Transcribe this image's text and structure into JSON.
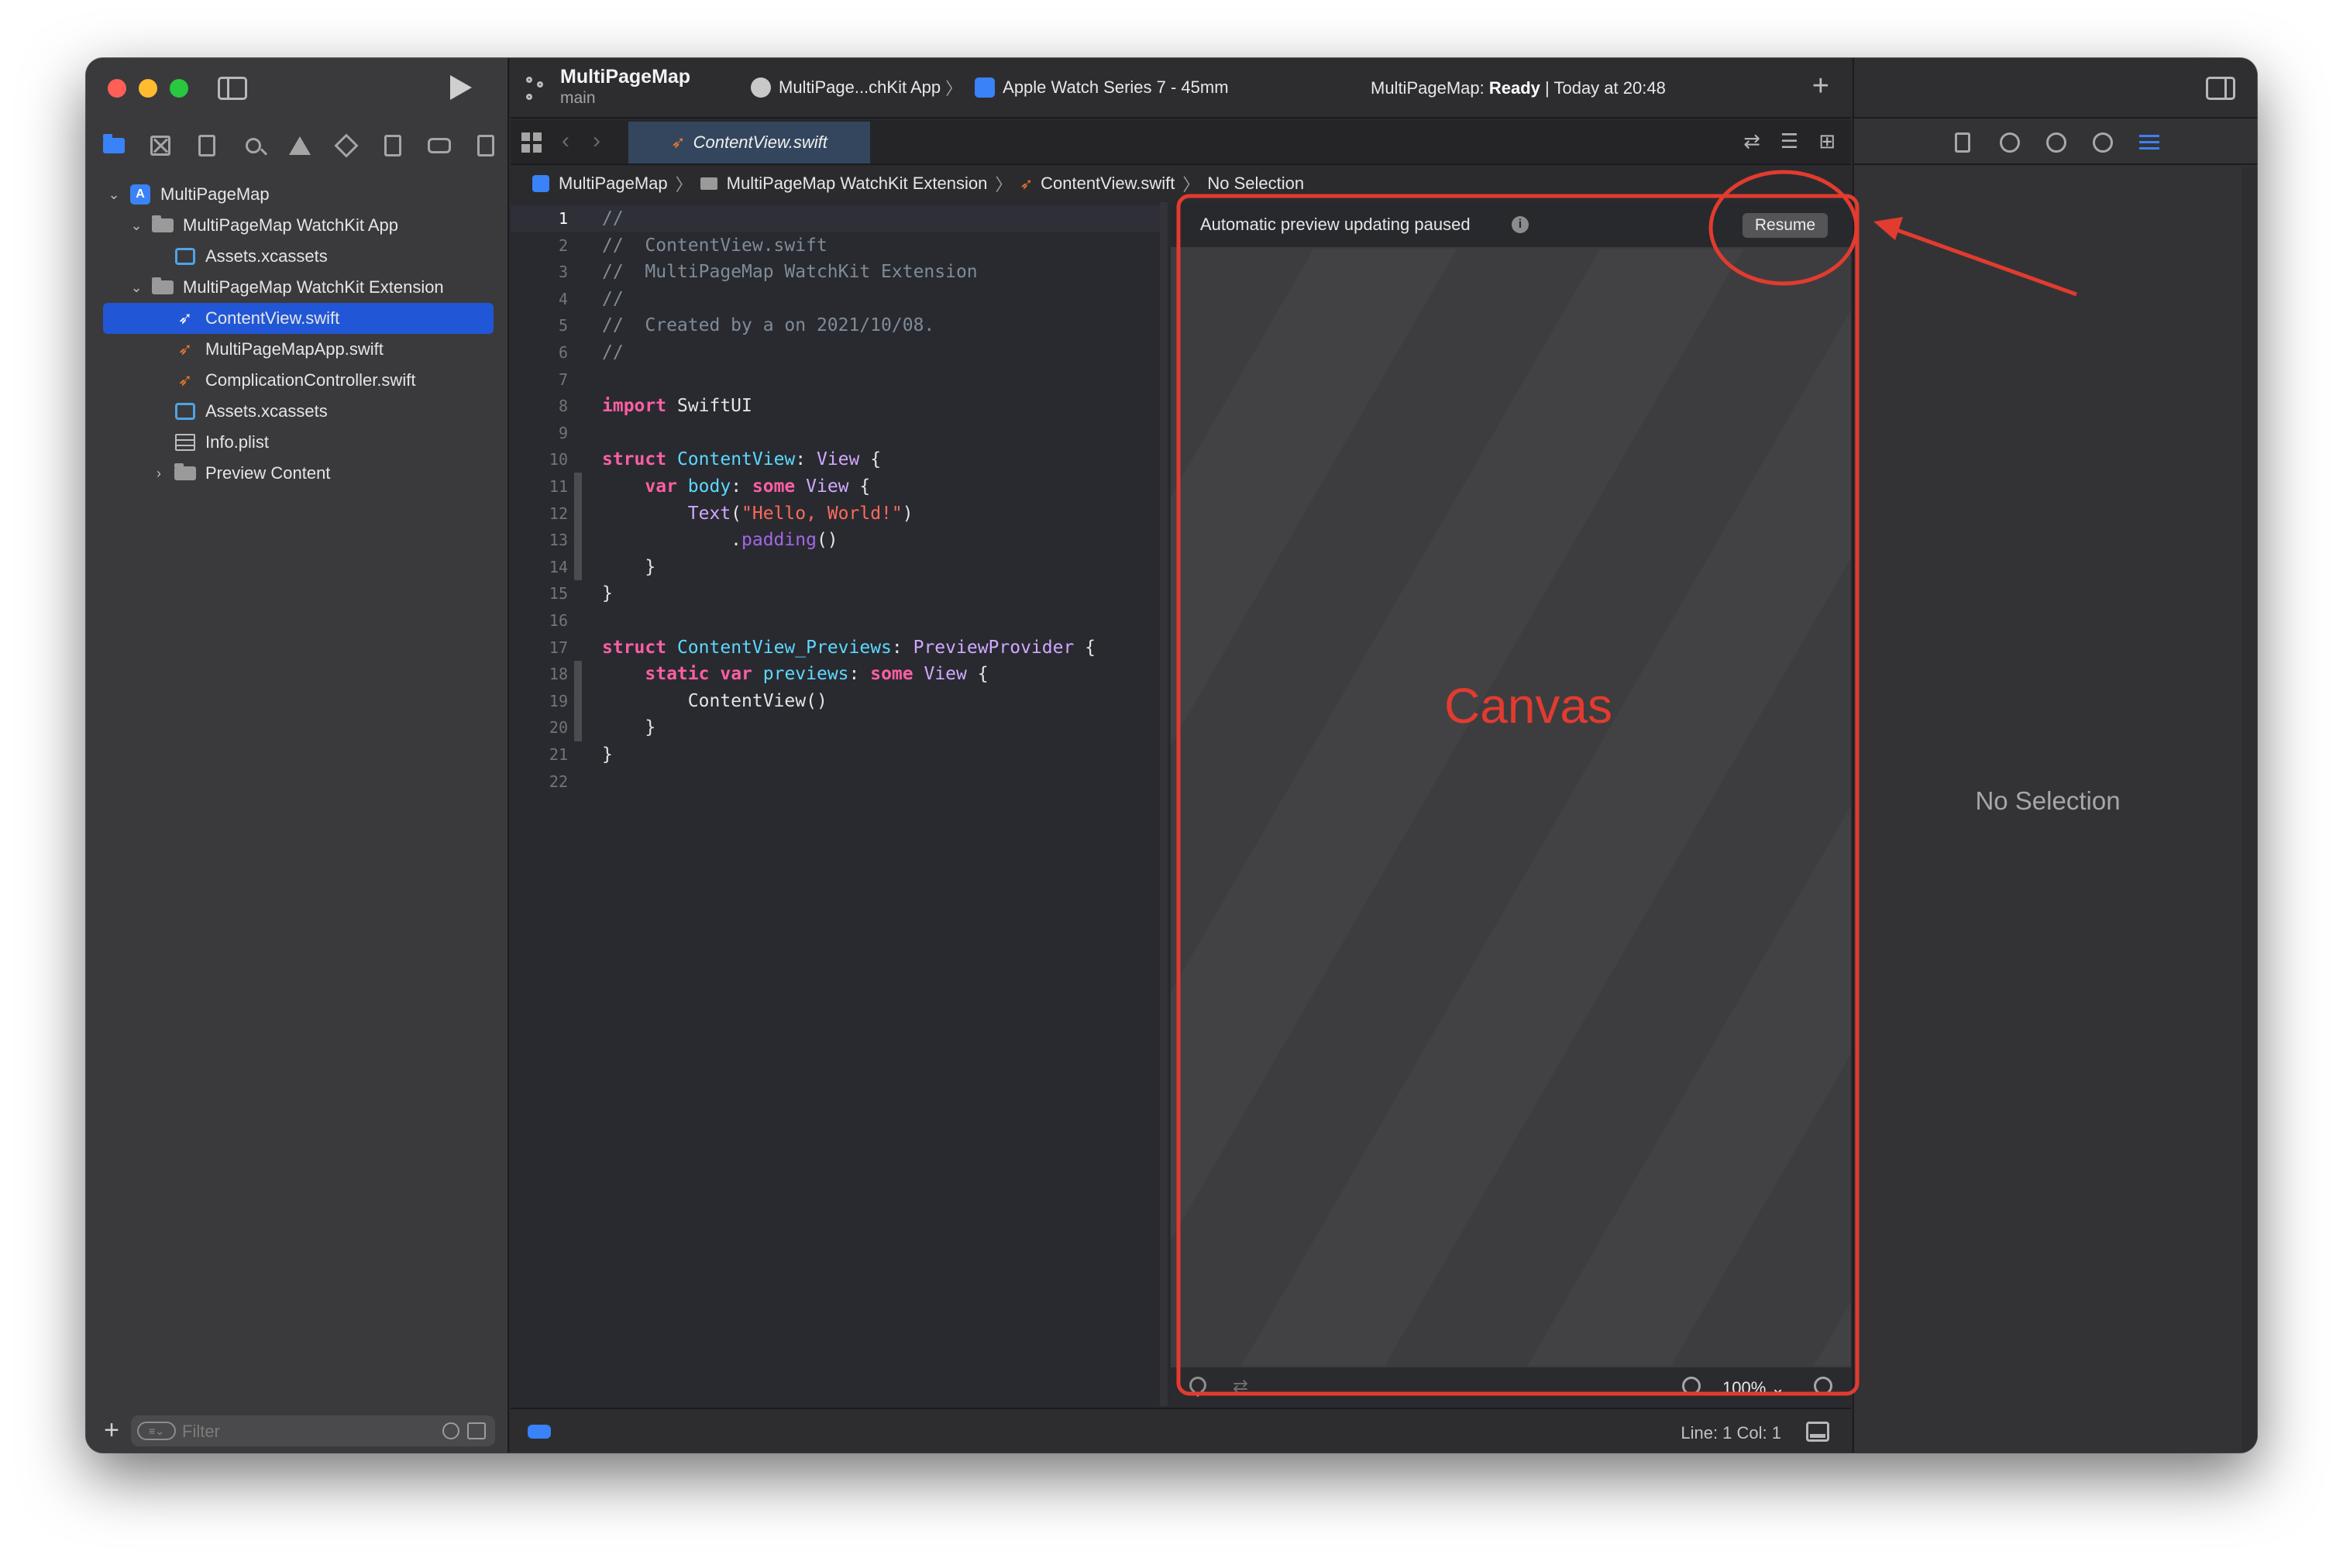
{
  "toolbar": {
    "project_name": "MultiPageMap",
    "branch": "main",
    "scheme_target": "MultiPage...chKit App",
    "device": "Apple Watch Series 7 - 45mm",
    "status_prefix": "MultiPageMap:",
    "status_state": "Ready",
    "status_suffix": "| Today at 20:48"
  },
  "navigator": {
    "items": [
      {
        "label": "MultiPageMap",
        "icon": "project-icon",
        "depth": 0,
        "disclosure": "expanded"
      },
      {
        "label": "MultiPageMap WatchKit App",
        "icon": "folder-icon",
        "depth": 1,
        "disclosure": "expanded"
      },
      {
        "label": "Assets.xcassets",
        "icon": "asset-catalog-icon",
        "depth": 2,
        "disclosure": "none"
      },
      {
        "label": "MultiPageMap WatchKit Extension",
        "icon": "folder-icon",
        "depth": 1,
        "disclosure": "expanded"
      },
      {
        "label": "ContentView.swift",
        "icon": "swift-file-icon",
        "depth": 2,
        "disclosure": "none",
        "selected": true
      },
      {
        "label": "MultiPageMapApp.swift",
        "icon": "swift-file-icon",
        "depth": 2,
        "disclosure": "none"
      },
      {
        "label": "ComplicationController.swift",
        "icon": "swift-file-icon",
        "depth": 2,
        "disclosure": "none"
      },
      {
        "label": "Assets.xcassets",
        "icon": "asset-catalog-icon",
        "depth": 2,
        "disclosure": "none"
      },
      {
        "label": "Info.plist",
        "icon": "plist-icon",
        "depth": 2,
        "disclosure": "none"
      },
      {
        "label": "Preview Content",
        "icon": "folder-icon",
        "depth": 2,
        "disclosure": "collapsed"
      }
    ],
    "filter_placeholder": "Filter"
  },
  "editor": {
    "tab_label": "ContentView.swift",
    "breadcrumb": {
      "project": "MultiPageMap",
      "group": "MultiPageMap WatchKit Extension",
      "file": "ContentView.swift",
      "symbol": "No Selection"
    },
    "current_line": 1,
    "lines": [
      [
        {
          "c": "c",
          "t": "//"
        }
      ],
      [
        {
          "c": "c",
          "t": "//  ContentView.swift"
        }
      ],
      [
        {
          "c": "c",
          "t": "//  MultiPageMap WatchKit Extension"
        }
      ],
      [
        {
          "c": "c",
          "t": "//"
        }
      ],
      [
        {
          "c": "c",
          "t": "//  Created by a on 2021/10/08."
        }
      ],
      [
        {
          "c": "c",
          "t": "//"
        }
      ],
      [],
      [
        {
          "c": "k",
          "t": "import"
        },
        {
          "c": "",
          "t": " SwiftUI"
        }
      ],
      [],
      [
        {
          "c": "k",
          "t": "struct"
        },
        {
          "c": "",
          "t": " "
        },
        {
          "c": "t",
          "t": "ContentView"
        },
        {
          "c": "",
          "t": ": "
        },
        {
          "c": "tp",
          "t": "View"
        },
        {
          "c": "",
          "t": " {"
        }
      ],
      [
        {
          "c": "",
          "t": "    "
        },
        {
          "c": "k",
          "t": "var"
        },
        {
          "c": "",
          "t": " "
        },
        {
          "c": "t",
          "t": "body"
        },
        {
          "c": "",
          "t": ": "
        },
        {
          "c": "k",
          "t": "some"
        },
        {
          "c": "",
          "t": " "
        },
        {
          "c": "tp",
          "t": "View"
        },
        {
          "c": "",
          "t": " {"
        }
      ],
      [
        {
          "c": "",
          "t": "        "
        },
        {
          "c": "tp",
          "t": "Text"
        },
        {
          "c": "",
          "t": "("
        },
        {
          "c": "s",
          "t": "\"Hello, World!\""
        },
        {
          "c": "",
          "t": ")"
        }
      ],
      [
        {
          "c": "",
          "t": "            ."
        },
        {
          "c": "f",
          "t": "padding"
        },
        {
          "c": "",
          "t": "()"
        }
      ],
      [
        {
          "c": "",
          "t": "    }"
        }
      ],
      [
        {
          "c": "",
          "t": "}"
        }
      ],
      [],
      [
        {
          "c": "k",
          "t": "struct"
        },
        {
          "c": "",
          "t": " "
        },
        {
          "c": "t",
          "t": "ContentView_Previews"
        },
        {
          "c": "",
          "t": ": "
        },
        {
          "c": "tp",
          "t": "PreviewProvider"
        },
        {
          "c": "",
          "t": " {"
        }
      ],
      [
        {
          "c": "",
          "t": "    "
        },
        {
          "c": "k",
          "t": "static"
        },
        {
          "c": "",
          "t": " "
        },
        {
          "c": "k",
          "t": "var"
        },
        {
          "c": "",
          "t": " "
        },
        {
          "c": "t",
          "t": "previews"
        },
        {
          "c": "",
          "t": ": "
        },
        {
          "c": "k",
          "t": "some"
        },
        {
          "c": "",
          "t": " "
        },
        {
          "c": "tp",
          "t": "View"
        },
        {
          "c": "",
          "t": " {"
        }
      ],
      [
        {
          "c": "",
          "t": "        ContentView()"
        }
      ],
      [
        {
          "c": "",
          "t": "    }"
        }
      ],
      [
        {
          "c": "",
          "t": "}"
        }
      ],
      []
    ]
  },
  "canvas": {
    "banner_text": "Automatic preview updating paused",
    "resume_label": "Resume",
    "annotation_label": "Canvas",
    "zoom_label": "100% ⌄"
  },
  "status_bar": {
    "line_col": "Line: 1  Col: 1"
  },
  "inspector": {
    "empty_label": "No Selection"
  },
  "colors": {
    "accent": "#3a82f7",
    "annotation_red": "#e23b2f",
    "swift_orange": "#f0782d"
  }
}
